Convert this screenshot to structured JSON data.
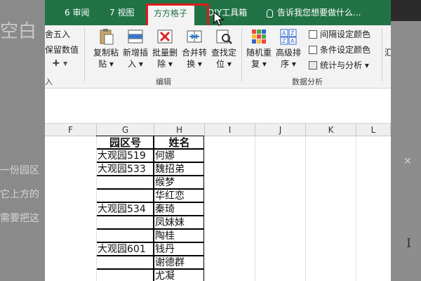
{
  "background": {
    "heading_fragment": "空白",
    "lines": [
      "一份园区",
      "它上方的",
      "需要把这"
    ]
  },
  "menubar": {
    "tabs": [
      {
        "id": "review",
        "label": "6 审阅"
      },
      {
        "id": "view",
        "label": "7 视图"
      },
      {
        "id": "ffgz",
        "label": "方方格子",
        "active": true
      },
      {
        "id": "diy",
        "label": "DIY工具箱"
      }
    ],
    "tell_me": "告诉我您想要做什么..."
  },
  "ribbon": {
    "left_items": {
      "round": "舍五入",
      "keep": "保留数值",
      "plus": "+"
    },
    "left_group_label": "入",
    "edit_buttons": [
      {
        "id": "copy-paste",
        "line1": "复制粘",
        "line2": "贴"
      },
      {
        "id": "add-insert",
        "line1": "新增插",
        "line2": "入"
      },
      {
        "id": "batch-delete",
        "line1": "批量删",
        "line2": "除"
      },
      {
        "id": "merge-convert",
        "line1": "合并转",
        "line2": "换"
      },
      {
        "id": "find-locate",
        "line1": "查找定",
        "line2": "位"
      }
    ],
    "edit_group_label": "编辑",
    "data_buttons": [
      {
        "id": "random-repeat",
        "line1": "随机重",
        "line2": "复"
      },
      {
        "id": "advanced-sort",
        "line1": "高级排",
        "line2": "序"
      }
    ],
    "data_list": [
      {
        "id": "interval-color",
        "label": "间隔设定颜色"
      },
      {
        "id": "cond-color",
        "label": "条件设定颜色"
      },
      {
        "id": "stats",
        "label": "统计与分析"
      }
    ],
    "data_group_label": "数据分析",
    "right_partial": "汇"
  },
  "sheet": {
    "columns": [
      "F",
      "G",
      "H",
      "I",
      "J",
      "K",
      "L"
    ],
    "headers": {
      "g": "园区号",
      "h": "姓名"
    },
    "rows": [
      {
        "g": "大观园519",
        "h": "何娜"
      },
      {
        "g": "大观园533",
        "h": "魏招弟"
      },
      {
        "g": "",
        "h": "缑梦"
      },
      {
        "g": "",
        "h": "华红恋"
      },
      {
        "g": "大观园534",
        "h": "秦琦"
      },
      {
        "g": "",
        "h": "凤妹妹"
      },
      {
        "g": "",
        "h": "陶桂"
      },
      {
        "g": "大观园601",
        "h": "钱丹"
      },
      {
        "g": "",
        "h": "谢德群"
      },
      {
        "g": "",
        "h": "尤凝"
      }
    ]
  },
  "colors": {
    "excel_green": "#217346",
    "highlight_red": "#e11a1a"
  }
}
